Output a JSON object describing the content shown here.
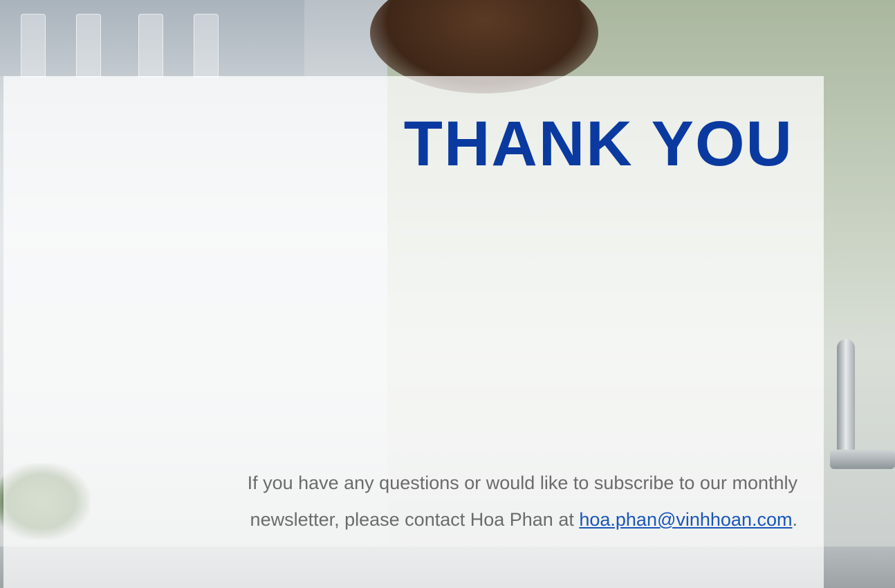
{
  "slide": {
    "title": "THANK YOU",
    "message_line1": "If you have any questions or would like to subscribe to our monthly",
    "message_line2_prefix": "newsletter, please contact Hoa Phan at ",
    "contact_email": "hoa.phan@vinhhoan.com",
    "message_line2_suffix": "."
  },
  "colors": {
    "title": "#0a3aa0",
    "body_text": "#6b6b6b",
    "link": "#1a56b8",
    "panel": "rgba(255,255,255,0.72)"
  }
}
